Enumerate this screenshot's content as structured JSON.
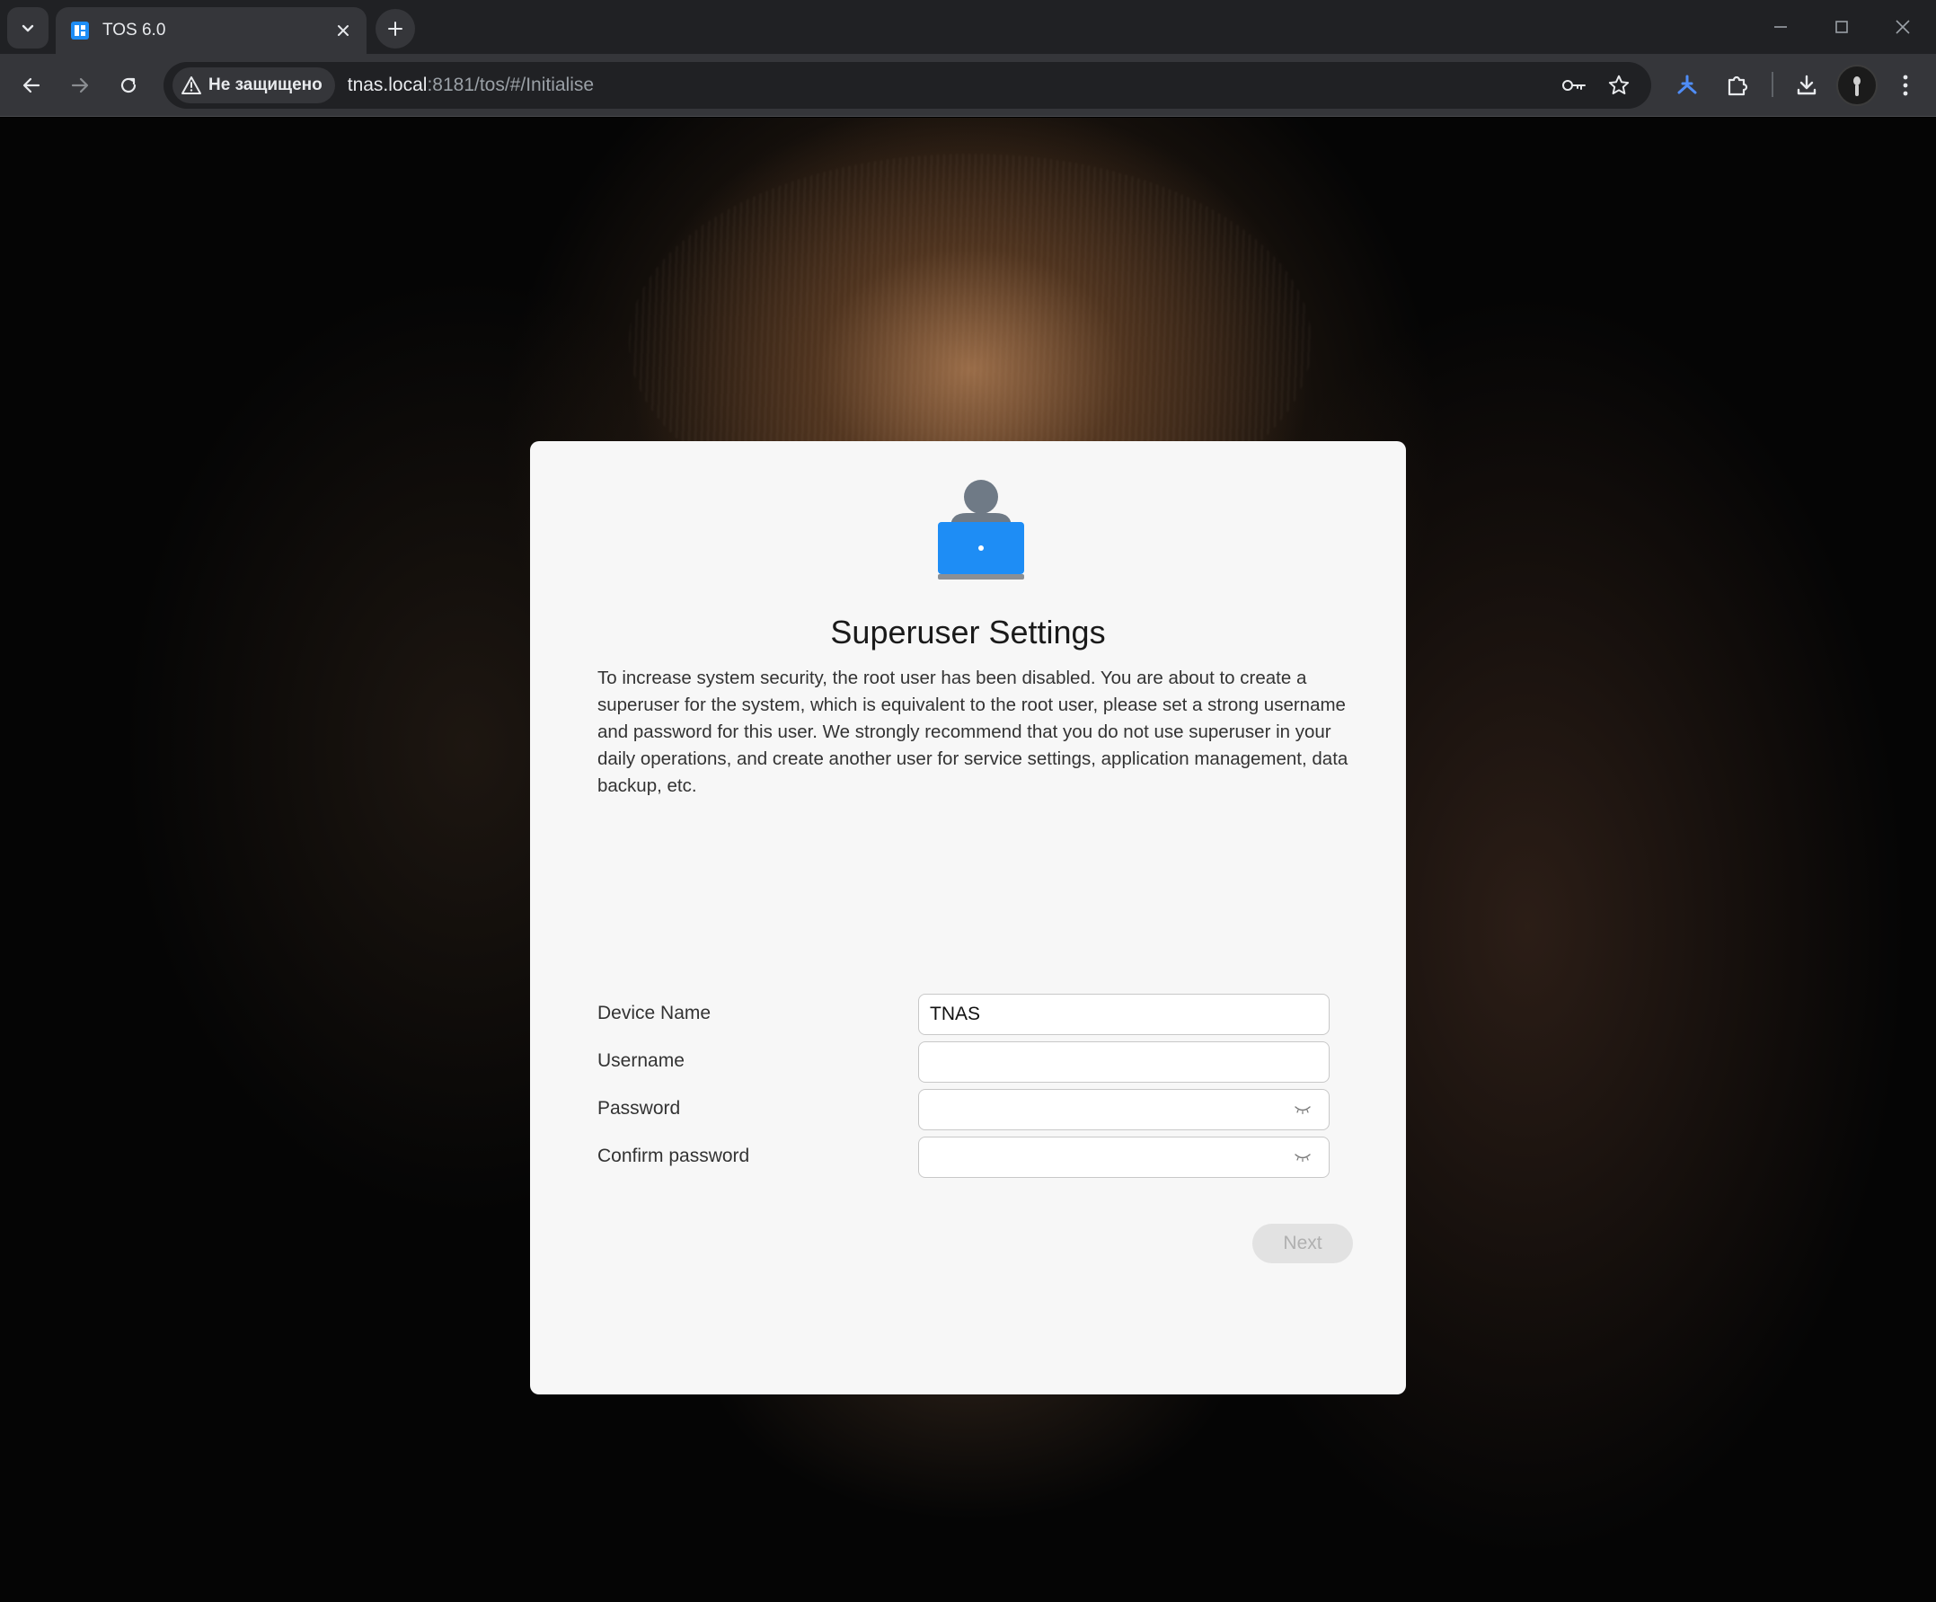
{
  "browser": {
    "tab_title": "TOS 6.0",
    "security_label": "Не защищено",
    "url_host": "tnas.local",
    "url_rest": ":8181/tos/#/Initialise"
  },
  "dialog": {
    "title": "Superuser Settings",
    "description": "To increase system security, the root user has been disabled. You are about to create a superuser for the system, which is equivalent to the root user, please set a strong username and password for this user. We strongly recommend that you do not use superuser in your daily operations, and create another user for service settings, application management, data backup, etc.",
    "fields": {
      "device_name": {
        "label": "Device Name",
        "value": "TNAS"
      },
      "username": {
        "label": "Username",
        "value": ""
      },
      "password": {
        "label": "Password",
        "value": ""
      },
      "confirm_password": {
        "label": "Confirm password",
        "value": ""
      }
    },
    "next_label": "Next"
  },
  "icons": {
    "tab_search": "chevron-down-icon",
    "favicon": "tos-logo-icon",
    "close": "close-icon",
    "new_tab": "plus-icon",
    "back": "arrow-left-icon",
    "forward": "arrow-right-icon",
    "reload": "reload-icon",
    "warning": "warning-triangle-icon",
    "password_manager": "key-icon",
    "bookmark": "star-icon",
    "extension_a": "extension-logo-icon",
    "extensions": "puzzle-icon",
    "download": "download-icon",
    "menu": "kebab-menu-icon",
    "eye": "eye-closed-icon",
    "hero": "user-laptop-icon"
  },
  "colors": {
    "chrome_dark": "#202124",
    "chrome_toolbar": "#35363a",
    "dialog_bg": "#f7f7f7",
    "accent_blue": "#1e8df5",
    "button_disabled": "#e2e2e2"
  }
}
